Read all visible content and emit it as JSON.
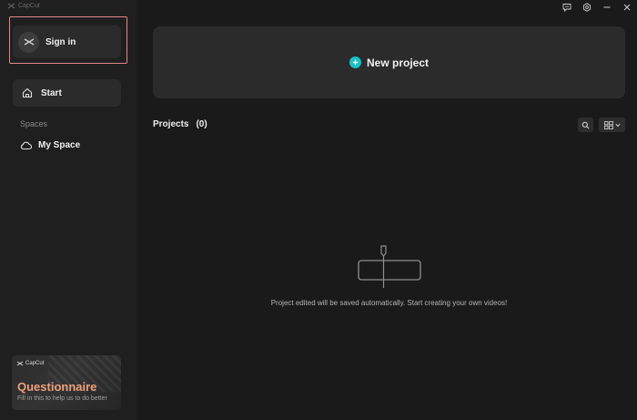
{
  "app": {
    "brand": "CapCut"
  },
  "sidebar": {
    "signin_label": "Sign in",
    "nav": {
      "start_label": "Start",
      "spaces_heading": "Spaces",
      "my_space_label": "My Space"
    },
    "promo": {
      "brand": "CapCut",
      "title": "Questionnaire",
      "subtitle": "Fill in this to help us to do better"
    }
  },
  "topbar": {
    "icons": [
      "feedback-icon",
      "settings-icon",
      "minimize-icon",
      "close-icon"
    ]
  },
  "main": {
    "new_project_label": "New project",
    "projects_heading": "Projects",
    "projects_count": "(0)",
    "empty_message": "Project edited will be saved automatically. Start creating your own videos!"
  },
  "colors": {
    "accent": "#19c2c8",
    "highlight_outline": "#e5868c",
    "promo_title": "#f0a07a"
  }
}
